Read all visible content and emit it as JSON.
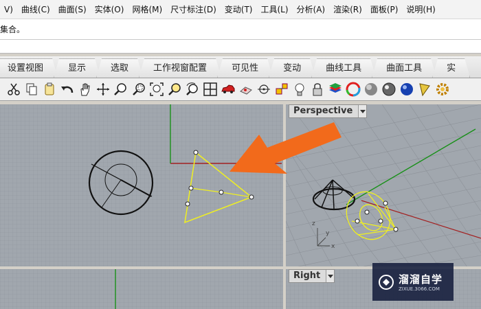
{
  "menubar": {
    "items": [
      "V)",
      "曲线(C)",
      "曲面(S)",
      "实体(O)",
      "网格(M)",
      "尺寸标注(D)",
      "变动(T)",
      "工具(L)",
      "分析(A)",
      "渲染(R)",
      "面板(P)",
      "说明(H)"
    ]
  },
  "command": {
    "history_text": "集合。"
  },
  "tabs": [
    "设置视图",
    "显示",
    "选取",
    "工作视窗配置",
    "可见性",
    "变动",
    "曲线工具",
    "曲面工具",
    "实"
  ],
  "toolbar": {
    "icons": [
      "cut-icon",
      "copy-icon",
      "paste-icon",
      "undo-icon",
      "pan-hand-icon",
      "rotate-view-icon",
      "zoom-icon",
      "zoom-window-icon",
      "zoom-extents-icon",
      "zoom-selected-icon",
      "rotate-camera-icon",
      "four-viewports-icon",
      "car-icon",
      "ortho-icon",
      "point-snap-icon",
      "object-snap-icon",
      "lightbulb-icon",
      "lock-icon",
      "layers-icon",
      "color-wheel-icon",
      "shaded-sphere-icon",
      "rendered-sphere-icon",
      "blue-sphere-icon",
      "cone-tool-icon",
      "gear-icon"
    ]
  },
  "viewports": {
    "perspective": {
      "label": "Perspective"
    },
    "right": {
      "label": "Right"
    }
  },
  "watermark": {
    "brand": "溜溜自学",
    "url": "ZIXUE.3066.COM"
  },
  "colors": {
    "grid_bg": "#9ea4ab",
    "grid_line": "#8a9097",
    "selection_yellow": "#f0f020",
    "x_axis": "#a32020",
    "y_axis": "#189018",
    "arrow": "#f26a1b"
  }
}
